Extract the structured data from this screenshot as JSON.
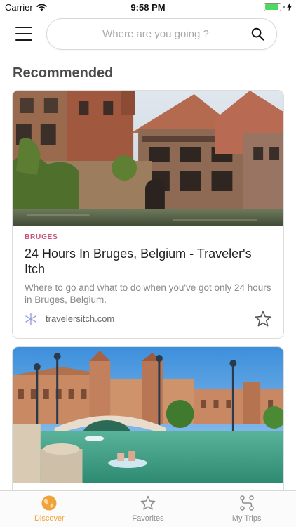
{
  "status_bar": {
    "carrier": "Carrier",
    "time": "9:58 PM",
    "battery_level": 0.92
  },
  "header": {
    "menu_icon": "hamburger-menu-icon",
    "search": {
      "placeholder": "Where are you going ?",
      "value": "",
      "icon": "search-icon"
    }
  },
  "section": {
    "title": "Recommended"
  },
  "cards": [
    {
      "tag": "BRUGES",
      "title": "24 Hours In Bruges, Belgium - Traveler's Itch",
      "description": "Where to go and what to do when you've got only 24 hours in Bruges, Belgium.",
      "source": "travelersitch.com",
      "source_icon": "snowflake-icon",
      "favorite_icon": "star-outline-icon",
      "favorited": false
    },
    {
      "tag": "",
      "title": "",
      "description": "",
      "source": ""
    }
  ],
  "tab_bar": {
    "tabs": [
      {
        "label": "Discover",
        "icon": "globe-icon",
        "active": true
      },
      {
        "label": "Favorites",
        "icon": "star-outline-icon",
        "active": false
      },
      {
        "label": "My Trips",
        "icon": "route-icon",
        "active": false
      }
    ]
  },
  "colors": {
    "accent": "#f0a33a",
    "tag": "#c4547a",
    "battery": "#4cd964",
    "tab_inactive": "#8e8e8e"
  }
}
